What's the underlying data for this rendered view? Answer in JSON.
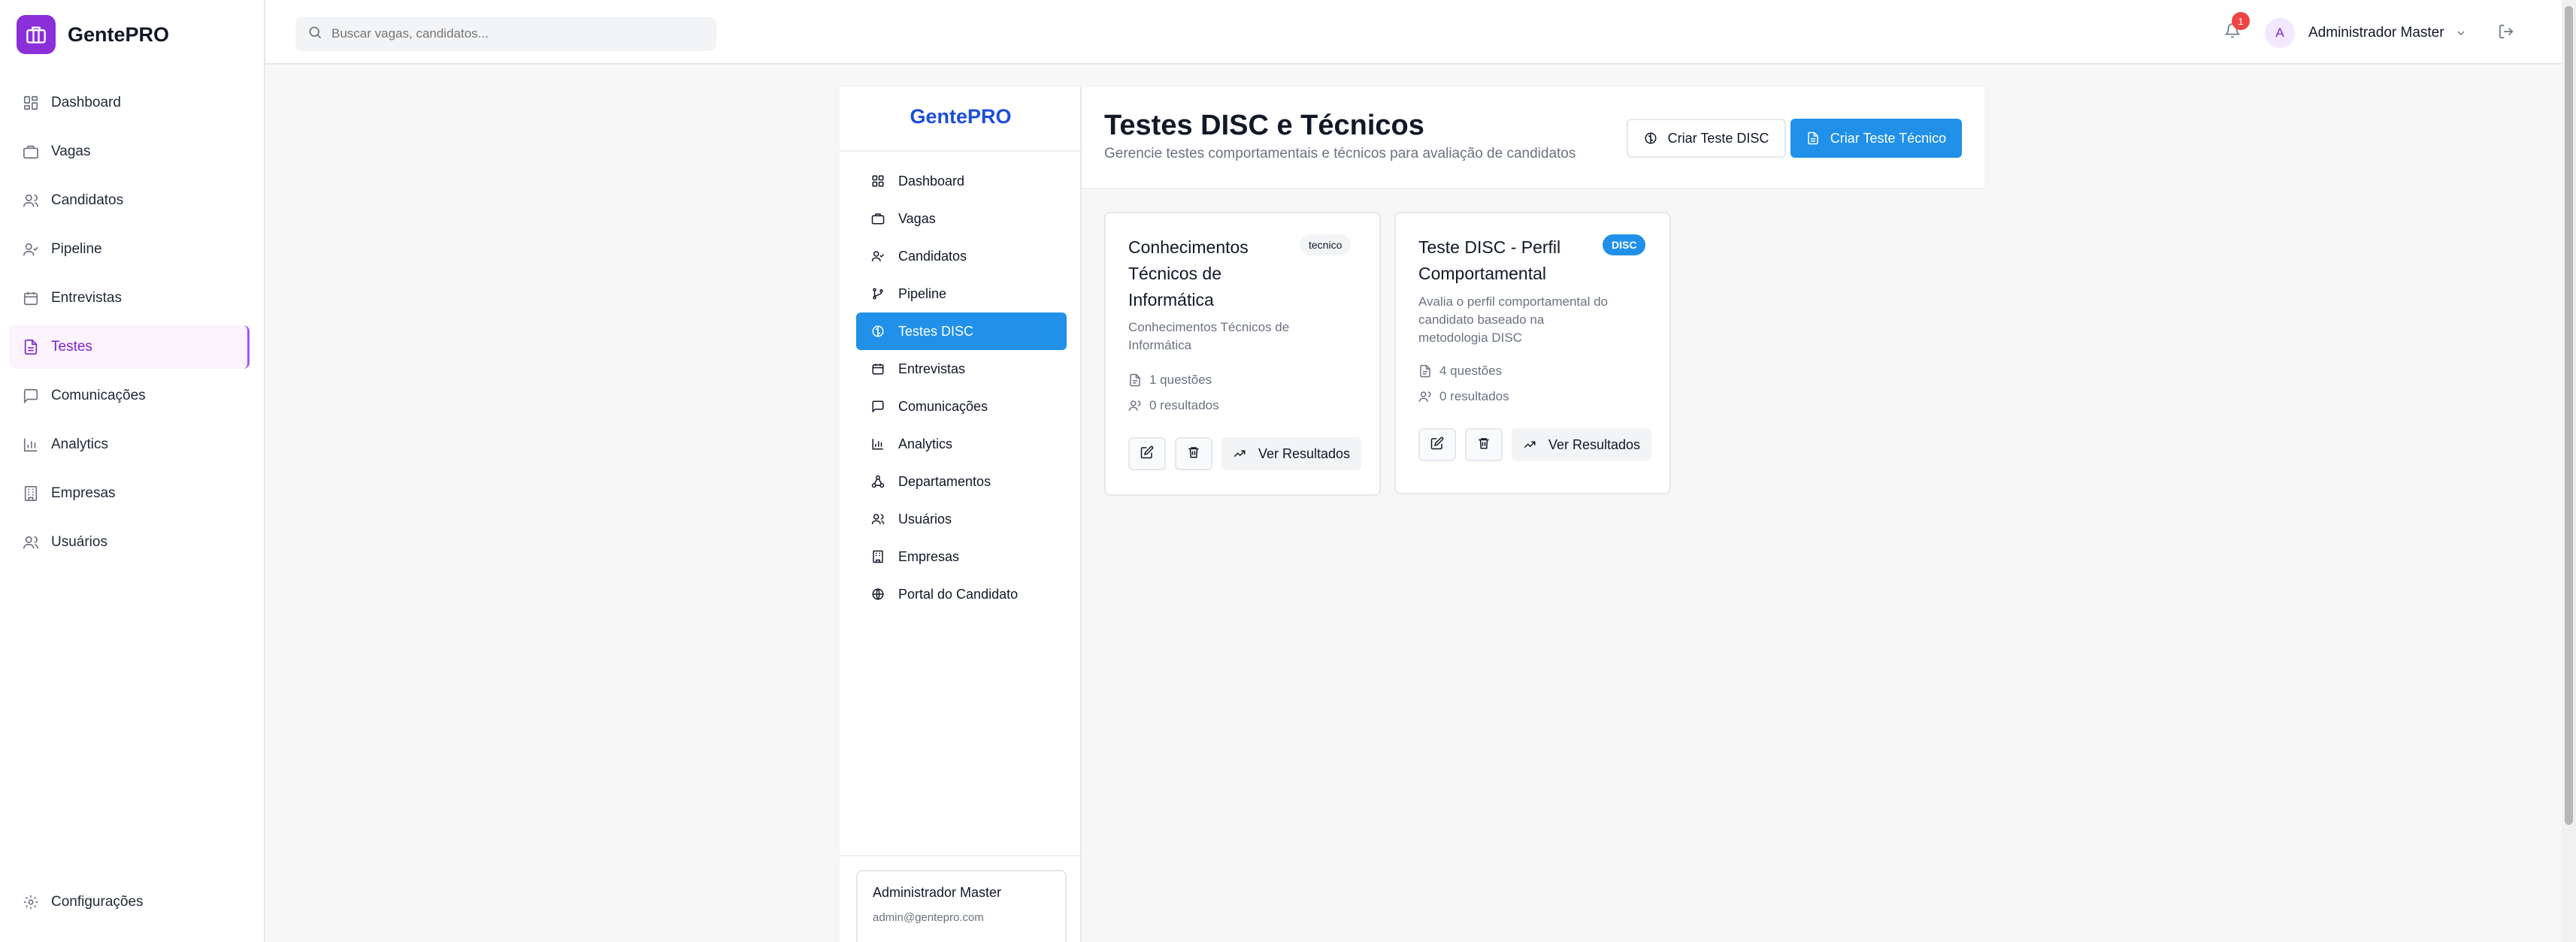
{
  "sidebar": {
    "brand": "GentePRO",
    "items": [
      {
        "label": "Dashboard",
        "icon": "dashboard-icon"
      },
      {
        "label": "Vagas",
        "icon": "briefcase-icon"
      },
      {
        "label": "Candidatos",
        "icon": "users-icon"
      },
      {
        "label": "Pipeline",
        "icon": "user-check-icon"
      },
      {
        "label": "Entrevistas",
        "icon": "calendar-icon"
      },
      {
        "label": "Testes",
        "icon": "file-text-icon",
        "active": true
      },
      {
        "label": "Comunicações",
        "icon": "message-icon"
      },
      {
        "label": "Analytics",
        "icon": "bar-chart-icon"
      },
      {
        "label": "Empresas",
        "icon": "building-icon"
      },
      {
        "label": "Usuários",
        "icon": "users-icon"
      }
    ],
    "settings_label": "Configurações"
  },
  "topbar": {
    "search_placeholder": "Buscar vagas, candidatos...",
    "notification_count": "1",
    "avatar_initial": "A",
    "user_name": "Administrador Master"
  },
  "inner_sidebar": {
    "brand": "GentePRO",
    "items": [
      {
        "label": "Dashboard"
      },
      {
        "label": "Vagas"
      },
      {
        "label": "Candidatos"
      },
      {
        "label": "Pipeline"
      },
      {
        "label": "Testes DISC",
        "active": true
      },
      {
        "label": "Entrevistas"
      },
      {
        "label": "Comunicações"
      },
      {
        "label": "Analytics"
      },
      {
        "label": "Departamentos"
      },
      {
        "label": "Usuários"
      },
      {
        "label": "Empresas"
      },
      {
        "label": "Portal do Candidato"
      }
    ],
    "user_name": "Administrador Master",
    "user_email": "admin@gentepro.com"
  },
  "main": {
    "title": "Testes DISC e Técnicos",
    "subtitle": "Gerencie testes comportamentais e técnicos para avaliação de candidatos",
    "btn_disc": "Criar Teste DISC",
    "btn_tec": "Criar Teste Técnico",
    "cards": [
      {
        "title": "Conhecimentos Técnicos de Informática",
        "badge": "tecnico",
        "description": "Conhecimentos Técnicos de Informática",
        "questions": "1 questões",
        "results": "0 resultados",
        "results_button": "Ver Resultados"
      },
      {
        "title": "Teste DISC - Perfil Comportamental",
        "badge": "DISC",
        "description": "Avalia o perfil comportamental do candidato baseado na metodologia DISC",
        "questions": "4 questões",
        "results": "0 resultados",
        "results_button": "Ver Resultados"
      }
    ]
  },
  "colors": {
    "brand_purple": "#8b2fd9",
    "active_purple": "#7e22ce",
    "primary_blue": "#2190e8",
    "inner_brand_blue": "#1d4ed8"
  }
}
